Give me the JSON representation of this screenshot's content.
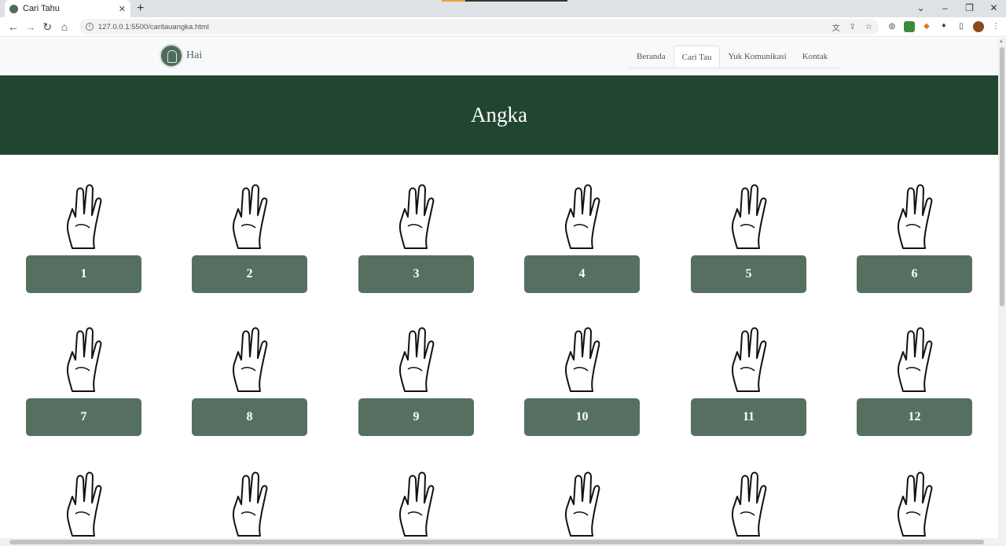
{
  "browser": {
    "tab_title": "Cari Tahu",
    "new_tab_symbol": "+",
    "url": "127.0.0.1:5500/caritauangka.html"
  },
  "site": {
    "brand": "Hai",
    "nav": [
      "Beranda",
      "Cari Tau",
      "Yuk Komunikasi",
      "Kontak"
    ],
    "active_nav": "Cari Tau",
    "page_title": "Angka"
  },
  "numbers": [
    "1",
    "2",
    "3",
    "4",
    "5",
    "6",
    "7",
    "8",
    "9",
    "10",
    "11",
    "12"
  ],
  "colors": {
    "banner": "#224530",
    "button": "#557060"
  }
}
